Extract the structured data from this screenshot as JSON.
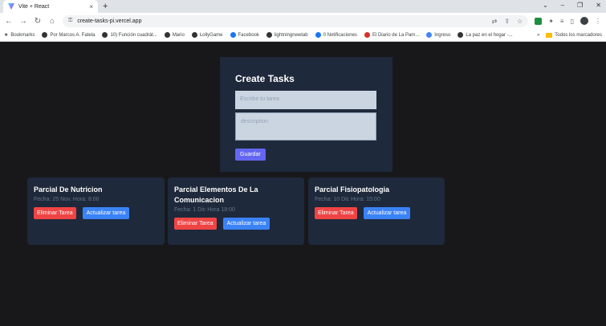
{
  "browser": {
    "tab_title": "Vite + React",
    "tab_close": "×",
    "new_tab": "+",
    "url": "create-tasks-pi.vercel.app",
    "back": "←",
    "forward": "→",
    "reload": "↻",
    "home": "⌂",
    "lock": "🔒",
    "bookmarks": [
      {
        "label": "Bookmarks",
        "icon": "star"
      },
      {
        "label": "Por Marcos A. Fatela",
        "icon": "globe"
      },
      {
        "label": "10) Función cuadrát...",
        "icon": "globe"
      },
      {
        "label": "Mario",
        "icon": "globe"
      },
      {
        "label": "LollyGame",
        "icon": "globe"
      },
      {
        "label": "Facebook",
        "icon": "facebook"
      },
      {
        "label": "lightningnewtab",
        "icon": "globe"
      },
      {
        "label": "0 Notificaciones",
        "icon": "facebook"
      },
      {
        "label": "El Diario de La Pam...",
        "icon": "red"
      },
      {
        "label": "Ingreso",
        "icon": "blue"
      },
      {
        "label": "La paz en el hogar -...",
        "icon": "globe"
      }
    ],
    "more_bookmarks": "»",
    "all_bookmarks": "Todos los marcadores"
  },
  "form": {
    "title": "Create Tasks",
    "task_placeholder": "Escribe tu tarea",
    "description_placeholder": "description",
    "save_label": "Guardar"
  },
  "tasks": [
    {
      "title": "Parcial De Nutricion",
      "date": "Fecha: 25 Nov. Hora: 8:00",
      "delete_label": "Eliminar Tarea",
      "update_label": "Actualizar tarea"
    },
    {
      "title": "Parcial Elementos De La Comunicacion",
      "date": "Fecha: 1 Dic Hora 18:00",
      "delete_label": "Eliminar Tarea",
      "update_label": "Actualizar tarea"
    },
    {
      "title": "Parcial Fisiopatologia",
      "date": "Fecha: 10 Dic Hora: 15:00",
      "delete_label": "Eliminar Tarea",
      "update_label": "Actualizar tarea"
    }
  ],
  "colors": {
    "background": "#18181b",
    "card": "#1e293b",
    "save": "#6366f1",
    "delete": "#ef4444",
    "update": "#3b82f6"
  }
}
